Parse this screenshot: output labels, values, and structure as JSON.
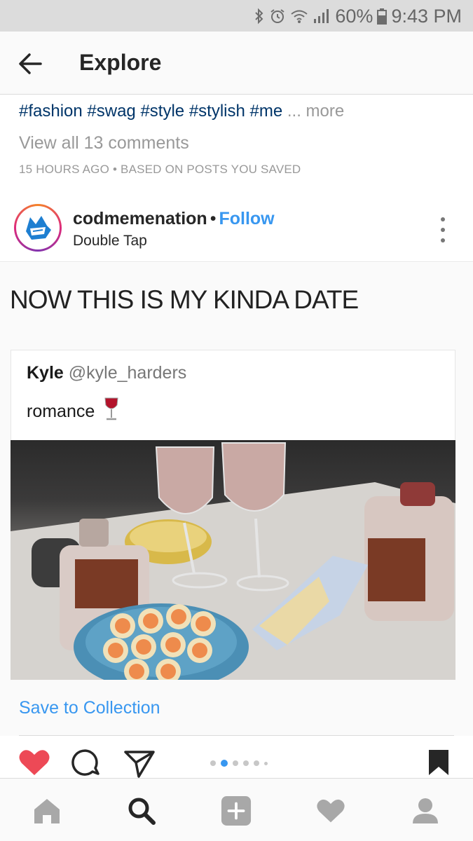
{
  "status_bar": {
    "battery": "60%",
    "time": "9:43 PM",
    "icons": [
      "bluetooth-icon",
      "alarm-icon",
      "wifi-icon",
      "signal-icon",
      "battery-icon"
    ]
  },
  "app_bar": {
    "title": "Explore",
    "back_icon": "arrow-left-icon"
  },
  "previous_post": {
    "hashtags": "#fashion #swag #style #stylish #me",
    "more_label": "... more",
    "view_comments": "View all 13 comments",
    "timestamp": "15 HOURS AGO",
    "context_sep": "•",
    "context": "BASED ON POSTS YOU SAVED"
  },
  "post": {
    "username": "codmemenation",
    "dot": "•",
    "follow_label": "Follow",
    "subtitle": "Double Tap",
    "more_icon": "more-vertical-icon",
    "caption_in_image": "NOW THIS IS MY KINDA DATE",
    "tweet": {
      "name": "Kyle",
      "handle": "@kyle_harders",
      "text": "romance",
      "emoji_icon": "wine-glass-icon"
    },
    "carousel": {
      "count": 6,
      "active_index": 1
    },
    "save_to_collection": "Save to Collection",
    "liked": true
  },
  "bottom_nav": {
    "items": [
      "home-icon",
      "search-icon",
      "add-icon",
      "activity-heart-icon",
      "profile-icon"
    ],
    "active": "search-icon"
  },
  "colors": {
    "link_blue": "#3897f0",
    "hashtag_blue": "#003569",
    "like_red": "#ed4956",
    "muted_gray": "#999999"
  }
}
